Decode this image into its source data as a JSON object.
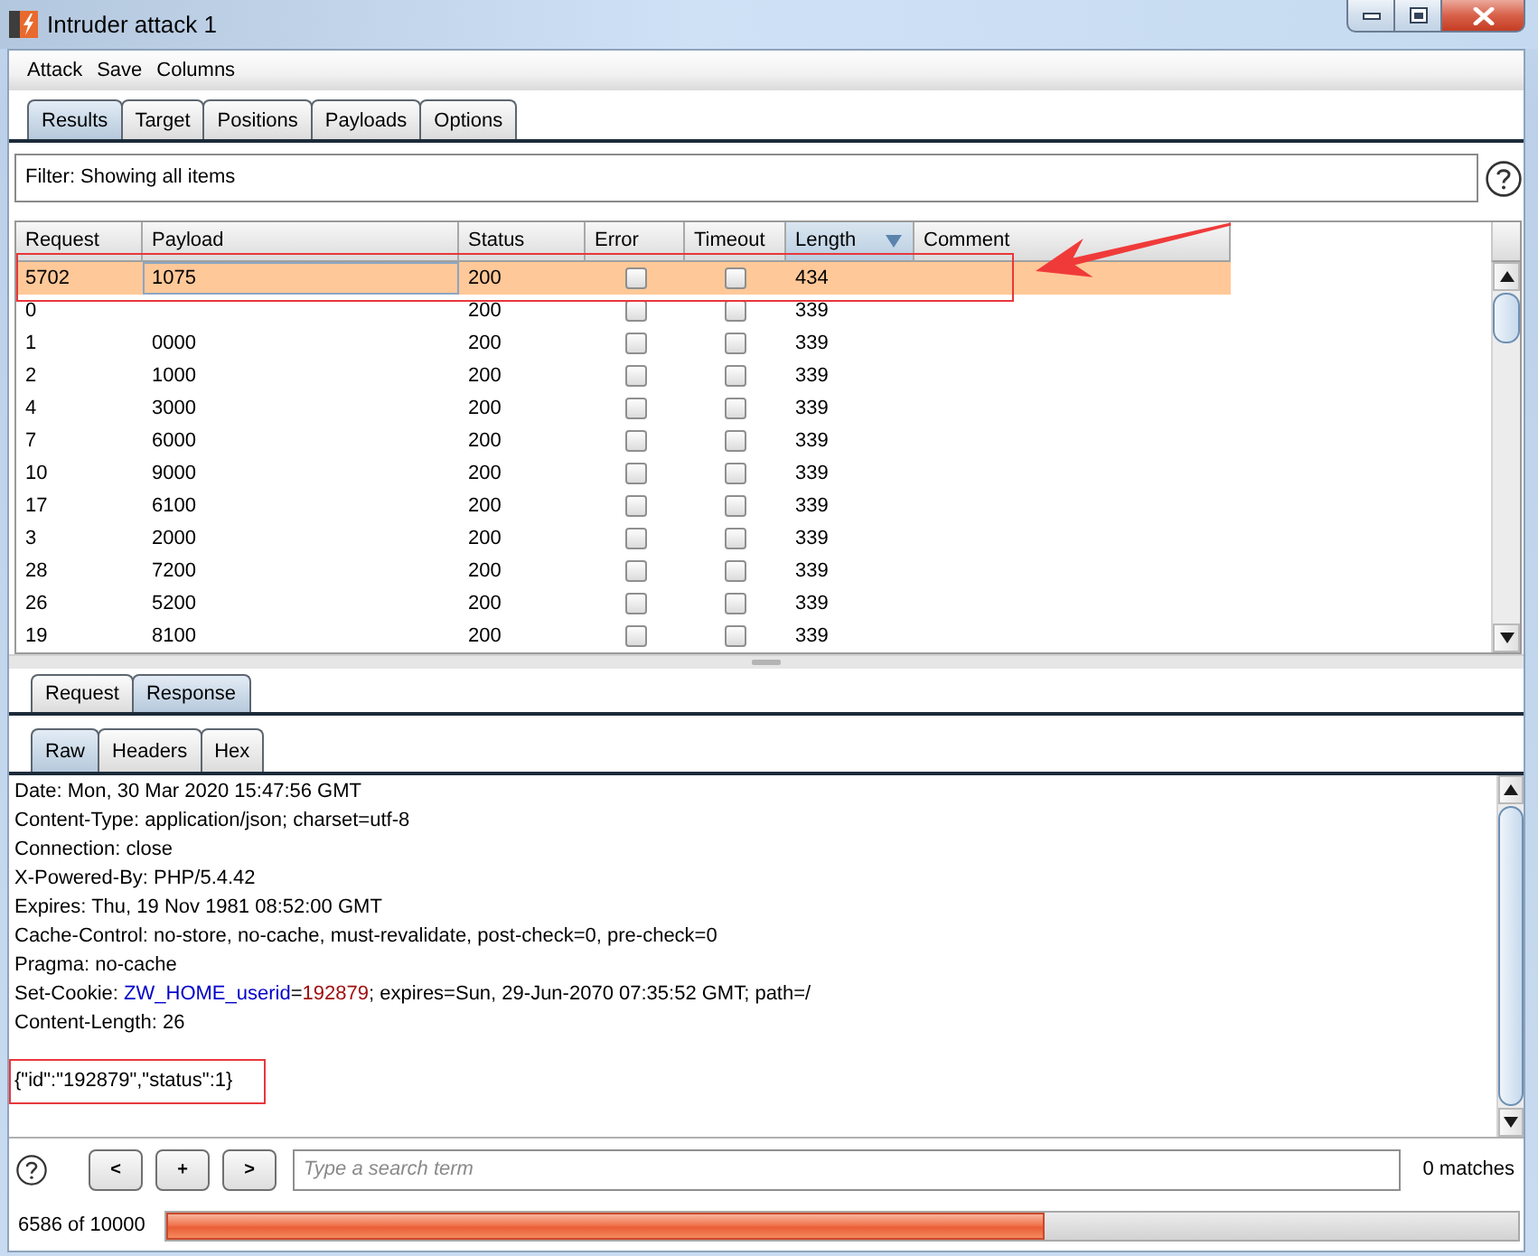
{
  "window": {
    "title": "Intruder attack 1"
  },
  "menu": [
    "Attack",
    "Save",
    "Columns"
  ],
  "tabs": [
    {
      "label": "Results",
      "selected": true
    },
    {
      "label": "Target",
      "selected": false
    },
    {
      "label": "Positions",
      "selected": false
    },
    {
      "label": "Payloads",
      "selected": false
    },
    {
      "label": "Options",
      "selected": false
    }
  ],
  "filter": {
    "text": "Filter: Showing all items"
  },
  "table": {
    "columns": [
      {
        "label": "Request",
        "kind": "text",
        "sorted": false
      },
      {
        "label": "Payload",
        "kind": "text",
        "sorted": false
      },
      {
        "label": "Status",
        "kind": "text",
        "sorted": false
      },
      {
        "label": "Error",
        "kind": "check",
        "sorted": false
      },
      {
        "label": "Timeout",
        "kind": "check",
        "sorted": false
      },
      {
        "label": "Length",
        "kind": "text",
        "sorted": true
      },
      {
        "label": "Comment",
        "kind": "text",
        "sorted": false
      }
    ],
    "rows": [
      {
        "request": "5702",
        "payload": "1075",
        "status": "200",
        "error": false,
        "timeout": false,
        "length": "434",
        "selected": true,
        "focused": true,
        "marked": true
      },
      {
        "request": "0",
        "status": "200",
        "error": false,
        "timeout": false,
        "length": "339",
        "selected": false,
        "focused": false,
        "marked": false
      },
      {
        "request": "1",
        "payload": "0000",
        "status": "200",
        "error": false,
        "timeout": false,
        "length": "339",
        "selected": false,
        "focused": false,
        "marked": false
      },
      {
        "request": "2",
        "payload": "1000",
        "status": "200",
        "error": false,
        "timeout": false,
        "length": "339",
        "selected": false,
        "focused": false,
        "marked": false
      },
      {
        "request": "4",
        "payload": "3000",
        "status": "200",
        "error": false,
        "timeout": false,
        "length": "339",
        "selected": false,
        "focused": false,
        "marked": false
      },
      {
        "request": "7",
        "payload": "6000",
        "status": "200",
        "error": false,
        "timeout": false,
        "length": "339",
        "selected": false,
        "focused": false,
        "marked": false
      },
      {
        "request": "10",
        "payload": "9000",
        "status": "200",
        "error": false,
        "timeout": false,
        "length": "339",
        "selected": false,
        "focused": false,
        "marked": false
      },
      {
        "request": "17",
        "payload": "6100",
        "status": "200",
        "error": false,
        "timeout": false,
        "length": "339",
        "selected": false,
        "focused": false,
        "marked": false
      },
      {
        "request": "3",
        "payload": "2000",
        "status": "200",
        "error": false,
        "timeout": false,
        "length": "339",
        "selected": false,
        "focused": false,
        "marked": false
      },
      {
        "request": "28",
        "payload": "7200",
        "status": "200",
        "error": false,
        "timeout": false,
        "length": "339",
        "selected": false,
        "focused": false,
        "marked": false
      },
      {
        "request": "26",
        "payload": "5200",
        "status": "200",
        "error": false,
        "timeout": false,
        "length": "339",
        "selected": false,
        "focused": false,
        "marked": false
      },
      {
        "request": "19",
        "payload": "8100",
        "status": "200",
        "error": false,
        "timeout": false,
        "length": "339",
        "selected": false,
        "focused": false,
        "marked": false
      }
    ]
  },
  "response_tabs": [
    {
      "label": "Request",
      "selected": false
    },
    {
      "label": "Response",
      "selected": true
    }
  ],
  "view_tabs": [
    {
      "label": "Raw",
      "selected": true
    },
    {
      "label": "Headers",
      "selected": false
    },
    {
      "label": "Hex",
      "selected": false
    }
  ],
  "response": {
    "lines": [
      {
        "parts": [
          {
            "kind": "plain",
            "text": "Date: Mon, 30 Mar 2020 15:47:56 GMT"
          }
        ]
      },
      {
        "parts": [
          {
            "kind": "plain",
            "text": "Content-Type: application/json; charset=utf-8"
          }
        ]
      },
      {
        "parts": [
          {
            "kind": "plain",
            "text": "Connection: close"
          }
        ]
      },
      {
        "parts": [
          {
            "kind": "plain",
            "text": "X-Powered-By: PHP/5.4.42"
          }
        ]
      },
      {
        "parts": [
          {
            "kind": "plain",
            "text": "Expires: Thu, 19 Nov 1981 08:52:00 GMT"
          }
        ]
      },
      {
        "parts": [
          {
            "kind": "plain",
            "text": "Cache-Control: no-store, no-cache, must-revalidate, post-check=0, pre-check=0"
          }
        ]
      },
      {
        "parts": [
          {
            "kind": "plain",
            "text": "Pragma: no-cache"
          }
        ]
      },
      {
        "parts": [
          {
            "kind": "plain",
            "text": "Set-Cookie: "
          },
          {
            "kind": "name",
            "text": "ZW_HOME_userid"
          },
          {
            "kind": "plain",
            "text": "="
          },
          {
            "kind": "value",
            "text": "192879"
          },
          {
            "kind": "plain",
            "text": "; expires=Sun, 29-Jun-2070 07:35:52 GMT; path=/"
          }
        ]
      },
      {
        "parts": [
          {
            "kind": "plain",
            "text": "Content-Length: 26"
          }
        ]
      }
    ],
    "body": {
      "text": "{\"id\":\"192879\",\"status\":1}",
      "marked": true
    }
  },
  "search": {
    "buttons": [
      "<",
      "+",
      ">"
    ],
    "placeholder": "Type a search term",
    "matches": "0 matches"
  },
  "progress": {
    "label": "6586 of 10000",
    "level": 0.65
  }
}
